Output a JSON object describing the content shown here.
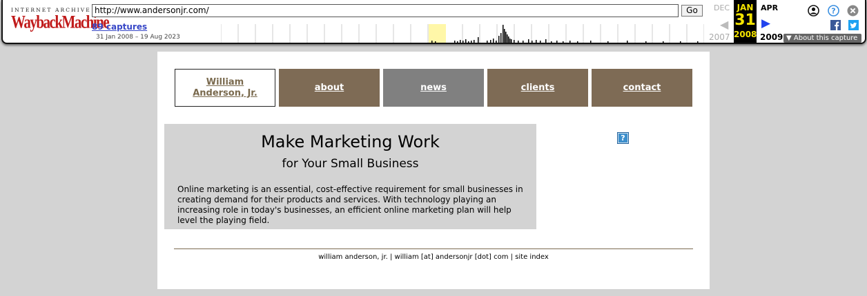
{
  "toolbar": {
    "logo_top": "INTERNET ARCHIVE",
    "logo_main": "WaybackMachine",
    "url_value": "http://www.andersonjr.com/",
    "go_label": "Go",
    "captures_label": "89 captures",
    "date_range": "31 Jan 2008 – 19 Aug 2023",
    "prev_month": "DEC",
    "prev_year": "2007",
    "current_month": "JAN",
    "current_day": "31",
    "current_year": "2008",
    "next_month": "APR",
    "next_year": "2009",
    "about_capture": "About this capture",
    "icons": [
      "user-icon",
      "help-icon",
      "close-icon",
      "facebook-icon",
      "twitter-icon"
    ],
    "colors": {
      "highlight": "#f5e400",
      "accent_blue": "#2244ee",
      "logo_red": "#c01a1a"
    }
  },
  "nav": {
    "home_line1": "William",
    "home_line2": "Anderson, Jr.",
    "items": [
      {
        "label": "about"
      },
      {
        "label": "news"
      },
      {
        "label": "clients"
      },
      {
        "label": "contact"
      }
    ],
    "colors": {
      "brown": "#7e6b55",
      "grey": "#808080"
    }
  },
  "hero": {
    "title": "Make Marketing Work",
    "subtitle": "for Your Small Business",
    "body": "Online marketing is an essential, cost-effective requirement for small businesses in creating demand for their products and services.  With technology playing an increasing role in today's businesses, an efficient online marketing plan will help level the playing field."
  },
  "help_icon_glyph": "?",
  "footer": {
    "text": "william anderson, jr. | william [at] andersonjr [dot] com | site index"
  }
}
